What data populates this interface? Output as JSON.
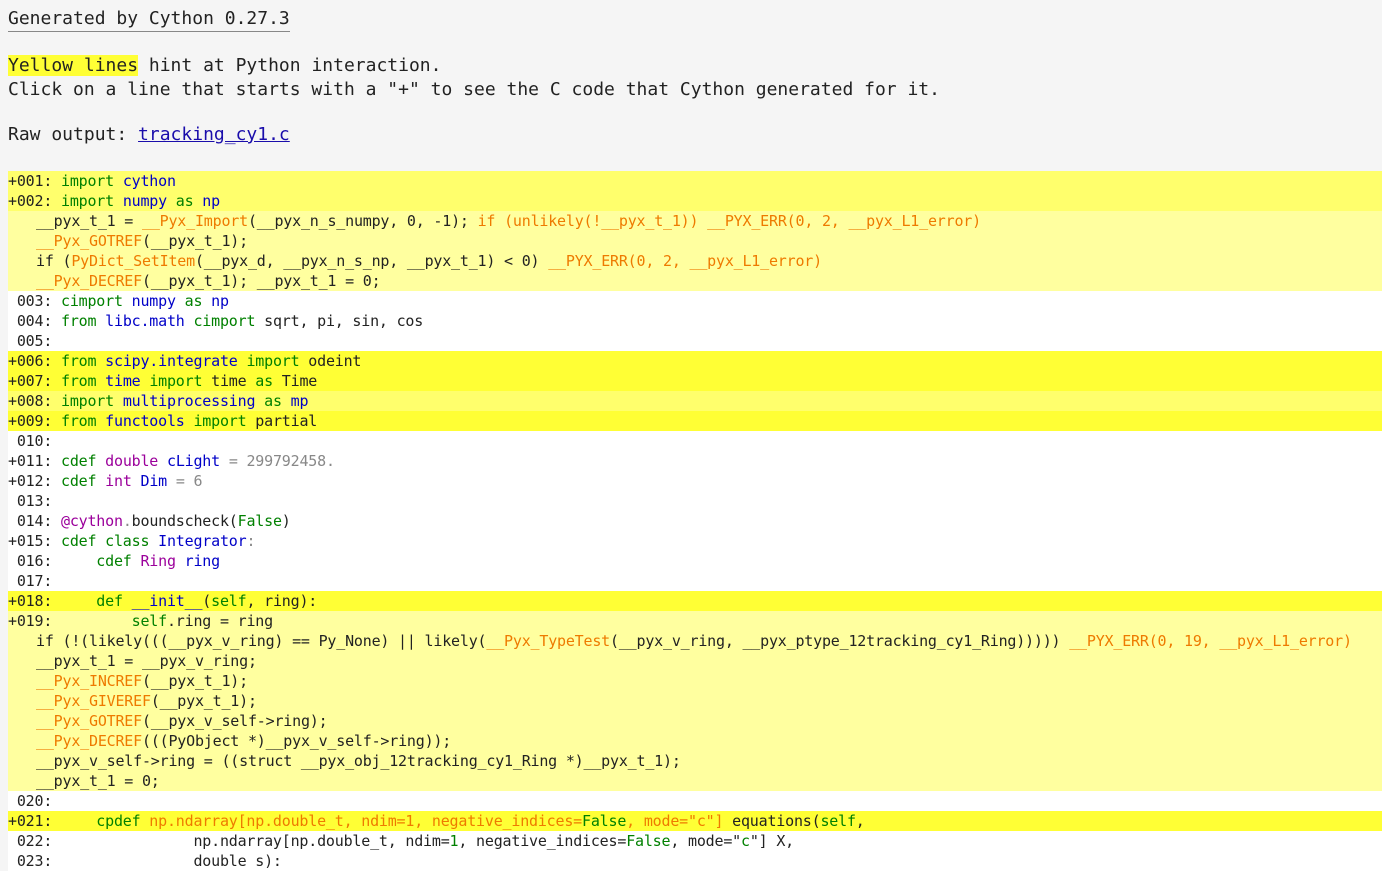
{
  "header": {
    "generated": "Generated by Cython 0.27.3",
    "hint_highlight": "Yellow lines",
    "hint_rest": " hint at Python interaction.",
    "click_hint": "Click on a line that starts with a \"+\" to see the C code that Cython generated for it.",
    "raw_label": "Raw output: ",
    "raw_link": "tracking_cy1.c"
  },
  "colors": {
    "bg_yellow_strong": "#ffff35",
    "bg_yellow_light": "#ffff9f",
    "bg_yellow_mid": "#ffff6c",
    "keyword": "#008000",
    "name": "#0000c8",
    "macro": "#ee7a00"
  },
  "lines": [
    {
      "bg": "#ffff6c",
      "num": "+001:",
      "segs": [
        [
          "k",
          " import "
        ],
        [
          "n",
          "cython"
        ]
      ]
    },
    {
      "bg": "#ffff6c",
      "num": "+002:",
      "segs": [
        [
          "k",
          " import "
        ],
        [
          "n",
          "numpy"
        ],
        [
          "k",
          " as "
        ],
        [
          "n",
          "np"
        ]
      ]
    },
    {
      "bg": "#ffff9f",
      "c": true,
      "segs": [
        [
          "",
          "__pyx_t_1 = "
        ],
        [
          "m",
          "__Pyx_Import"
        ],
        [
          "",
          "(__pyx_n_s_numpy, 0, -1); "
        ],
        [
          "m",
          "if (unlikely(!__pyx_t_1)) __PYX_ERR(0, 2, __pyx_L1_error)"
        ]
      ]
    },
    {
      "bg": "#ffff9f",
      "c": true,
      "segs": [
        [
          "m",
          "__Pyx_GOTREF"
        ],
        [
          "",
          "(__pyx_t_1);"
        ]
      ]
    },
    {
      "bg": "#ffff9f",
      "c": true,
      "segs": [
        [
          "",
          "if ("
        ],
        [
          "m",
          "PyDict_SetItem"
        ],
        [
          "",
          "(__pyx_d, __pyx_n_s_np, __pyx_t_1) < 0) "
        ],
        [
          "m",
          "__PYX_ERR(0, 2, __pyx_L1_error)"
        ]
      ]
    },
    {
      "bg": "#ffff9f",
      "c": true,
      "segs": [
        [
          "m",
          "__Pyx_DECREF"
        ],
        [
          "",
          "(__pyx_t_1); __pyx_t_1 = 0;"
        ]
      ]
    },
    {
      "bg": "#ffffff",
      "num": " 003:",
      "segs": [
        [
          "k",
          " cimport "
        ],
        [
          "n",
          "numpy"
        ],
        [
          "k",
          " as "
        ],
        [
          "n",
          "np"
        ]
      ]
    },
    {
      "bg": "#ffffff",
      "num": " 004:",
      "segs": [
        [
          "k",
          " from "
        ],
        [
          "n",
          "libc.math"
        ],
        [
          "k",
          " cimport "
        ],
        [
          "",
          "sqrt, pi, sin, cos"
        ]
      ]
    },
    {
      "bg": "#ffffff",
      "num": " 005:",
      "segs": []
    },
    {
      "bg": "#ffff35",
      "num": "+006:",
      "segs": [
        [
          "k",
          " from "
        ],
        [
          "n",
          "scipy.integrate"
        ],
        [
          "k",
          " import "
        ],
        [
          "",
          "odeint"
        ]
      ]
    },
    {
      "bg": "#ffff35",
      "num": "+007:",
      "segs": [
        [
          "k",
          " from "
        ],
        [
          "n",
          "time"
        ],
        [
          "k",
          " import "
        ],
        [
          "",
          "time "
        ],
        [
          "k",
          "as "
        ],
        [
          "",
          "Time"
        ]
      ]
    },
    {
      "bg": "#ffff6c",
      "num": "+008:",
      "segs": [
        [
          "k",
          " import "
        ],
        [
          "n",
          "multiprocessing"
        ],
        [
          "k",
          " as "
        ],
        [
          "n",
          "mp"
        ]
      ]
    },
    {
      "bg": "#ffff35",
      "num": "+009:",
      "segs": [
        [
          "k",
          " from "
        ],
        [
          "n",
          "functools"
        ],
        [
          "k",
          " import "
        ],
        [
          "",
          "partial"
        ]
      ]
    },
    {
      "bg": "#ffffff",
      "num": " 010:",
      "segs": []
    },
    {
      "bg": "#ffffff",
      "num": "+011:",
      "segs": [
        [
          "k",
          " cdef "
        ],
        [
          "p",
          "double"
        ],
        [
          "n",
          " cLight"
        ],
        [
          "g",
          " = 299792458."
        ]
      ]
    },
    {
      "bg": "#ffffff",
      "num": "+012:",
      "segs": [
        [
          "k",
          " cdef "
        ],
        [
          "p",
          "int"
        ],
        [
          "n",
          " Dim"
        ],
        [
          "g",
          " = 6"
        ]
      ]
    },
    {
      "bg": "#ffffff",
      "num": " 013:",
      "segs": []
    },
    {
      "bg": "#ffffff",
      "num": " 014:",
      "segs": [
        [
          "p",
          " @cython"
        ],
        [
          "g",
          "."
        ],
        [
          "",
          "boundscheck("
        ],
        [
          "k",
          "False"
        ],
        [
          "",
          ")"
        ]
      ]
    },
    {
      "bg": "#ffffff",
      "num": "+015:",
      "segs": [
        [
          "k",
          " cdef class "
        ],
        [
          "n",
          "Integrator"
        ],
        [
          "g",
          ":"
        ]
      ]
    },
    {
      "bg": "#ffffff",
      "num": " 016:",
      "segs": [
        [
          "k",
          "     cdef "
        ],
        [
          "p",
          "Ring"
        ],
        [
          "n",
          " ring"
        ]
      ]
    },
    {
      "bg": "#ffffff",
      "num": " 017:",
      "segs": []
    },
    {
      "bg": "#ffff35",
      "num": "+018:",
      "segs": [
        [
          "k",
          "     def "
        ],
        [
          "n",
          "__init__"
        ],
        [
          "",
          "("
        ],
        [
          "k",
          "self"
        ],
        [
          "",
          ", ring):"
        ]
      ]
    },
    {
      "bg": "#ffff9f",
      "num": "+019:",
      "segs": [
        [
          "k",
          "         self"
        ],
        [
          "",
          ".ring = ring"
        ]
      ]
    },
    {
      "bg": "#ffff9f",
      "c": true,
      "segs": [
        [
          "",
          "if (!(likely(((__pyx_v_ring) == Py_None) || likely("
        ],
        [
          "m",
          "__Pyx_TypeTest"
        ],
        [
          "",
          "(__pyx_v_ring, __pyx_ptype_12tracking_cy1_Ring))))) "
        ],
        [
          "m",
          "__PYX_ERR(0, 19, __pyx_L1_error)"
        ]
      ]
    },
    {
      "bg": "#ffff9f",
      "c": true,
      "segs": [
        [
          "",
          "__pyx_t_1 = __pyx_v_ring;"
        ]
      ]
    },
    {
      "bg": "#ffff9f",
      "c": true,
      "segs": [
        [
          "m",
          "__Pyx_INCREF"
        ],
        [
          "",
          "(__pyx_t_1);"
        ]
      ]
    },
    {
      "bg": "#ffff9f",
      "c": true,
      "segs": [
        [
          "m",
          "__Pyx_GIVEREF"
        ],
        [
          "",
          "(__pyx_t_1);"
        ]
      ]
    },
    {
      "bg": "#ffff9f",
      "c": true,
      "segs": [
        [
          "m",
          "__Pyx_GOTREF"
        ],
        [
          "",
          "(__pyx_v_self->ring);"
        ]
      ]
    },
    {
      "bg": "#ffff9f",
      "c": true,
      "segs": [
        [
          "m",
          "__Pyx_DECREF"
        ],
        [
          "",
          "(((PyObject *)__pyx_v_self->ring));"
        ]
      ]
    },
    {
      "bg": "#ffff9f",
      "c": true,
      "segs": [
        [
          "",
          "__pyx_v_self->ring = ((struct __pyx_obj_12tracking_cy1_Ring *)__pyx_t_1);"
        ]
      ]
    },
    {
      "bg": "#ffff9f",
      "c": true,
      "segs": [
        [
          "",
          "__pyx_t_1 = 0;"
        ]
      ]
    },
    {
      "bg": "#ffffff",
      "num": " 020:",
      "segs": []
    },
    {
      "bg": "#ffff35",
      "num": "+021:",
      "segs": [
        [
          "k",
          "     cpdef "
        ],
        [
          "m",
          "np.ndarray[np.double_t, ndim=1, negative_indices="
        ],
        [
          "k",
          "False"
        ],
        [
          "m",
          ", mode=\"c\"]"
        ],
        [
          "",
          " equations("
        ],
        [
          "k",
          "self"
        ],
        [
          "",
          ","
        ]
      ]
    },
    {
      "bg": "#ffffff",
      "num": " 022:",
      "segs": [
        [
          "",
          "                np.ndarray[np.double_t, ndim="
        ],
        [
          "k",
          "1"
        ],
        [
          "",
          ", negative_indices="
        ],
        [
          "k",
          "False"
        ],
        [
          "",
          ", mode=\""
        ],
        [
          "k",
          "c"
        ],
        [
          "",
          "\"] X,"
        ]
      ]
    },
    {
      "bg": "#ffffff",
      "num": " 023:",
      "segs": [
        [
          "",
          "                double s):"
        ]
      ]
    }
  ]
}
